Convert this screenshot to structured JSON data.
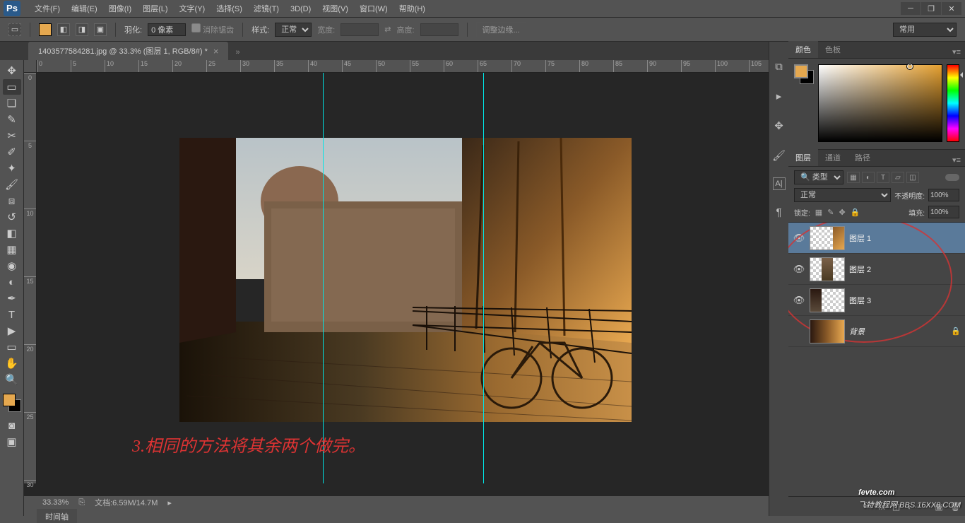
{
  "titlebar": {
    "logo": "Ps",
    "menus": [
      "文件(F)",
      "编辑(E)",
      "图像(I)",
      "图层(L)",
      "文字(Y)",
      "选择(S)",
      "滤镜(T)",
      "3D(D)",
      "视图(V)",
      "窗口(W)",
      "帮助(H)"
    ]
  },
  "optionsbar": {
    "feather_label": "羽化:",
    "feather_value": "0 像素",
    "antialias": "消除锯齿",
    "style_label": "样式:",
    "style_value": "正常",
    "width_label": "宽度:",
    "height_label": "高度:",
    "refine": "调整边缘...",
    "workspace": "常用"
  },
  "doc_tab": {
    "title": "1403577584281.jpg @ 33.3% (图层 1, RGB/8#) *"
  },
  "ruler_h": [
    "0",
    "5",
    "10",
    "15",
    "20",
    "25",
    "30",
    "35",
    "40",
    "45",
    "50",
    "55",
    "60",
    "65",
    "70",
    "75",
    "80",
    "85",
    "90",
    "95",
    "100",
    "105"
  ],
  "ruler_v": [
    "0",
    "5",
    "10",
    "15",
    "20",
    "25",
    "30"
  ],
  "annotation_text": "3.相同的方法将其余两个做完。",
  "statusbar": {
    "zoom": "33.33%",
    "doc": "文档:6.59M/14.7M"
  },
  "timeline_tab": "时间轴",
  "panels": {
    "color_tab": "颜色",
    "swatch_tab": "色板",
    "layers_tab": "图层",
    "channels_tab": "通道",
    "paths_tab": "路径",
    "filter_type": "类型",
    "blend_mode": "正常",
    "opacity_label": "不透明度:",
    "opacity_value": "100%",
    "lock_label": "锁定:",
    "fill_label": "填充:",
    "fill_value": "100%"
  },
  "layers": [
    {
      "name": "图层 1",
      "visible": true,
      "selected": true,
      "locked": false,
      "strip": "right"
    },
    {
      "name": "图层 2",
      "visible": true,
      "selected": false,
      "locked": false,
      "strip": "mid"
    },
    {
      "name": "图层 3",
      "visible": true,
      "selected": false,
      "locked": false,
      "strip": "left"
    },
    {
      "name": "背景",
      "visible": false,
      "selected": false,
      "locked": true,
      "strip": "full",
      "italic": true
    }
  ],
  "watermark": {
    "main": "fevte.com",
    "sub": "飞特教程网 BBS.16XX8.COM"
  }
}
